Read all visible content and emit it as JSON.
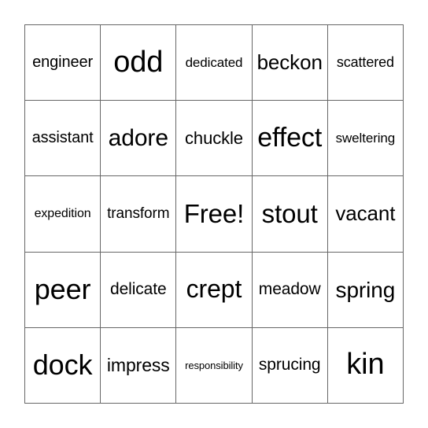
{
  "card": {
    "type": "bingo-card",
    "grid_size": 5,
    "free_space": {
      "row": 2,
      "column": 2,
      "label": "Free!"
    },
    "colors": {
      "background": "#ffffff",
      "border": "#666666",
      "text": "#000000"
    },
    "cells": [
      {
        "text": "engineer",
        "font_size": 20,
        "row": 0,
        "column": 0
      },
      {
        "text": "odd",
        "font_size": 38,
        "row": 0,
        "column": 1
      },
      {
        "text": "dedicated",
        "font_size": 17,
        "row": 0,
        "column": 2
      },
      {
        "text": "beckon",
        "font_size": 26,
        "row": 0,
        "column": 3
      },
      {
        "text": "scattered",
        "font_size": 18,
        "row": 0,
        "column": 4
      },
      {
        "text": "assistant",
        "font_size": 20,
        "row": 1,
        "column": 0
      },
      {
        "text": "adore",
        "font_size": 30,
        "row": 1,
        "column": 1
      },
      {
        "text": "chuckle",
        "font_size": 22,
        "row": 1,
        "column": 2
      },
      {
        "text": "effect",
        "font_size": 34,
        "row": 1,
        "column": 3
      },
      {
        "text": "sweltering",
        "font_size": 17,
        "row": 1,
        "column": 4
      },
      {
        "text": "expedition",
        "font_size": 16,
        "row": 2,
        "column": 0
      },
      {
        "text": "transform",
        "font_size": 19,
        "row": 2,
        "column": 1
      },
      {
        "text": "Free!",
        "font_size": 33,
        "row": 2,
        "column": 2
      },
      {
        "text": "stout",
        "font_size": 33,
        "row": 2,
        "column": 3
      },
      {
        "text": "vacant",
        "font_size": 26,
        "row": 2,
        "column": 4
      },
      {
        "text": "peer",
        "font_size": 36,
        "row": 3,
        "column": 0
      },
      {
        "text": "delicate",
        "font_size": 21,
        "row": 3,
        "column": 1
      },
      {
        "text": "crept",
        "font_size": 32,
        "row": 3,
        "column": 2
      },
      {
        "text": "meadow",
        "font_size": 21,
        "row": 3,
        "column": 3
      },
      {
        "text": "spring",
        "font_size": 28,
        "row": 3,
        "column": 4
      },
      {
        "text": "dock",
        "font_size": 36,
        "row": 4,
        "column": 0
      },
      {
        "text": "impress",
        "font_size": 23,
        "row": 4,
        "column": 1
      },
      {
        "text": "responsibility",
        "font_size": 13,
        "row": 4,
        "column": 2
      },
      {
        "text": "sprucing",
        "font_size": 21,
        "row": 4,
        "column": 3
      },
      {
        "text": "kin",
        "font_size": 38,
        "row": 4,
        "column": 4
      }
    ]
  }
}
